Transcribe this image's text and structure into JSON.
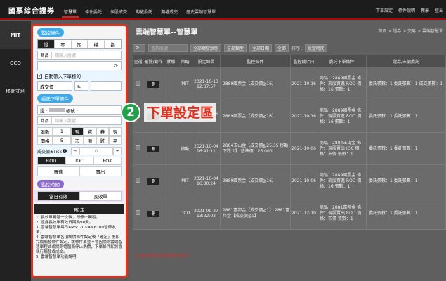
{
  "topbar": {
    "brand": "國票綜合證券",
    "nav": [
      "智慧單",
      "條件委託",
      "個股成交",
      "期權委託",
      "期權成交",
      "歷史雲端智慧單"
    ],
    "right": [
      "下單設定",
      "條件說明",
      "教學",
      "登出"
    ]
  },
  "leftnav": [
    "MIT",
    "OCO",
    "移動守利"
  ],
  "panel": {
    "monitor_head": "監控條件",
    "tabs": [
      "證",
      "零",
      "期",
      "權",
      "指"
    ],
    "product_label": "商品",
    "product_placeholder": "請輸入股號",
    "auto_bring": "自動帶入下單標的",
    "cond_field": "成交價",
    "cond_op": "≥",
    "order_head": "委託下單條件",
    "account": "證 : ",
    "account_after": "帳號 : ",
    "order_product_label": "商品",
    "order_product_placeholder": "請輸入股號",
    "price_label": "張數",
    "price_value": "1",
    "price_opts": [
      "現",
      "資",
      "券",
      "現"
    ],
    "qty_label": "價格",
    "qty_value": "5",
    "qty_opts": [
      "市",
      "漲",
      "跌",
      "平"
    ],
    "tick_label": "成交價±Tick",
    "tick_value": "0",
    "types": [
      "ROD",
      "IOC",
      "FOK"
    ],
    "sides": [
      "買進",
      "賣出"
    ],
    "time_head": "監控時間",
    "time_opts": [
      "當日有效",
      "長效單"
    ],
    "confirm": "確 定",
    "notes": [
      "1. 長效單觸發一次後，即停止觸發。",
      "2. 證券長效單有效日期為90天。",
      "3. 雲端智慧單每日AM5: 20~AM6: 00暫停收單。",
      "4. 雲端智慧單各項觸價條件設定後「確定」後即完成觸發條件設定，該條件單並不會因關閉雲端智慧單程式或關閉電腦而停止洗價，下單條件即將會執行觸發或成交。",
      "5. 雲端智慧單功能說明"
    ]
  },
  "callout": {
    "number": "2",
    "text": "下單設定區"
  },
  "content": {
    "title": "雲端智慧單--智慧單",
    "crumb": "首頁 > 證券 > 交易 > 雲端智慧單",
    "filter_search_placeholder": "查詢股號",
    "filters": [
      "全部觸發狀態",
      "全部類型",
      "全部日期",
      "全部"
    ],
    "sort_label": "排序 :",
    "sort_value": "設定時間",
    "columns": [
      "全選",
      "刪除/動作",
      "狀態",
      "策略",
      "設定時間",
      "監控條件",
      "監控截止日",
      "委託下單條件",
      "證券/市價委託"
    ],
    "rows": [
      {
        "action": "刪",
        "status": "",
        "strategy": "MIT",
        "time": "2021-10-13 12:37:57",
        "cond": "2889國票金【成交價≧16】",
        "end": "2021-10-16",
        "order": "商品：2889國票金 條件：現股買進 ROD 價格：16 張數：1",
        "price": "委託張數：1 委託張數：1 成交張數：1"
      },
      {
        "action": "刪",
        "status": "",
        "strategy": "MIT",
        "time": "2021-10-05 14:48:36",
        "cond": "2889國票金【成交價≧16】",
        "end": "2021-10-16",
        "order": "商品：2889國票金 條件：現股買進 ROD 價格：16 張數：1",
        "price": "委託張數：1 委託張數：1"
      },
      {
        "action": "刪",
        "status": "",
        "strategy": "移動",
        "time": "2021-10-04 16:41:11",
        "cond": "2884玉山金【成交價≧25.35 移動下跌 1】 基準價：26.000",
        "end": "2021-10-06",
        "order": "商品：2884玉山金 條件：現股賣出 IOC 價格：市價 張數：1",
        "price": "委託張數：1 委託張數：1"
      },
      {
        "action": "刪",
        "status": "",
        "strategy": "MIT",
        "time": "2021-10-04 16:30:24",
        "cond": "2889國票金【成交價≧16】",
        "end": "2021-10-06",
        "order": "商品：2889國票金 條件：現股買進 ROD 價格：16 張數：1",
        "price": "委託張數：1 委託張數：1"
      },
      {
        "action": "刪",
        "status": "",
        "strategy": "OCO",
        "time": "2021-09-27 13:22:03",
        "cond": "2881富邦金【成交價≧1】 2881富邦金【成交價≦1】",
        "end": "2021-12-10",
        "order": "商品：2881富邦金 條件：現股賣出 ROD 價格：市價 張數：1",
        "price": "委託張數：1 委託張數：1"
      }
    ],
    "footer_note": "此雲端智慧單僅供觸價條件設定"
  }
}
